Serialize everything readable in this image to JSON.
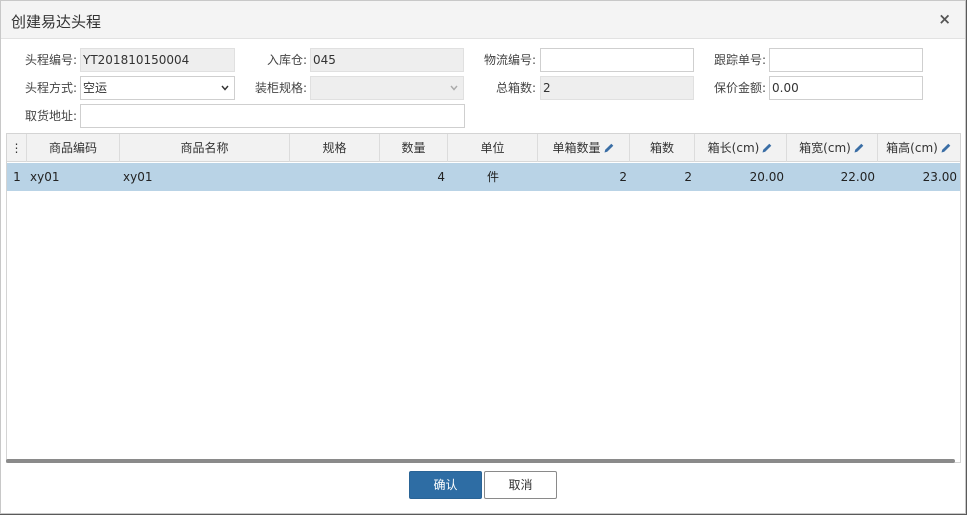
{
  "dialog": {
    "title": "创建易达头程",
    "close_symbol": "×"
  },
  "form": {
    "head_no": {
      "label": "头程编号:",
      "value": "YT201810150004"
    },
    "warehouse": {
      "label": "入库仓:",
      "value": "045"
    },
    "logistics_no": {
      "label": "物流编号:",
      "value": ""
    },
    "tracking_no": {
      "label": "跟踪单号:",
      "value": ""
    },
    "method": {
      "label": "头程方式:",
      "value": "空运"
    },
    "container_spec": {
      "label": "装柜规格:",
      "value": ""
    },
    "total_boxes": {
      "label": "总箱数:",
      "value": "2"
    },
    "insured_amount": {
      "label": "保价金额:",
      "value": "0.00"
    },
    "pickup_address": {
      "label": "取货地址:",
      "value": ""
    }
  },
  "grid": {
    "menu_symbol": "⋮",
    "columns": [
      {
        "key": "code",
        "label": "商品编码",
        "editable": false
      },
      {
        "key": "name",
        "label": "商品名称",
        "editable": false
      },
      {
        "key": "spec",
        "label": "规格",
        "editable": false
      },
      {
        "key": "qty",
        "label": "数量",
        "editable": false
      },
      {
        "key": "unit",
        "label": "单位",
        "editable": false
      },
      {
        "key": "per_box",
        "label": "单箱数量",
        "editable": true
      },
      {
        "key": "boxes",
        "label": "箱数",
        "editable": false
      },
      {
        "key": "length",
        "label": "箱长(cm)",
        "editable": true
      },
      {
        "key": "width",
        "label": "箱宽(cm)",
        "editable": true
      },
      {
        "key": "height",
        "label": "箱高(cm)",
        "editable": true
      }
    ],
    "rows": [
      {
        "index": "1",
        "code": "xy01",
        "name": "xy01",
        "spec": "",
        "qty": "4",
        "unit": "件",
        "per_box": "2",
        "boxes": "2",
        "length": "20.00",
        "width": "22.00",
        "height": "23.00"
      }
    ]
  },
  "buttons": {
    "confirm": "确认",
    "cancel": "取消"
  },
  "colors": {
    "primary": "#2e6da4",
    "selected_row": "#b9d3e6",
    "pencil": "#3a6ea5"
  }
}
